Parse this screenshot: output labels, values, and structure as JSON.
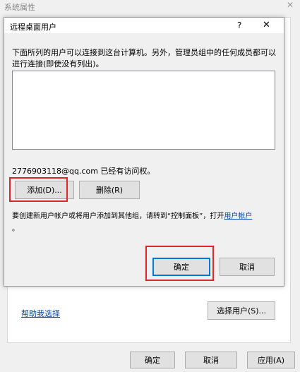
{
  "outer": {
    "title": "系统属性",
    "close_glyph": "✕",
    "help_link": "帮助我选择",
    "select_users_button": "选择用户(S)...",
    "ok_button": "确定",
    "cancel_button": "取消",
    "apply_button": "应用(A)"
  },
  "dialog": {
    "title": "远程桌面用户",
    "help_glyph": "?",
    "close_glyph": "✕",
    "description": "下面所列的用户可以连接到这台计算机。另外，管理员组中的任何成员都可以进行连接(即使没有列出)。",
    "users_list": [],
    "access_text": "2776903118@qq.com 已经有访问权。",
    "add_button": "添加(D)...",
    "remove_button": "删除(R)",
    "hint_prefix": "要创建新用户帐户或将用户添加到其他组，请转到“控制面板”，打开",
    "hint_link": "用户帐户",
    "hint_suffix": "。",
    "ok_button": "确定",
    "cancel_button": "取消"
  },
  "colors": {
    "highlight_red": "#e0262b",
    "link_blue": "#0645ad"
  }
}
